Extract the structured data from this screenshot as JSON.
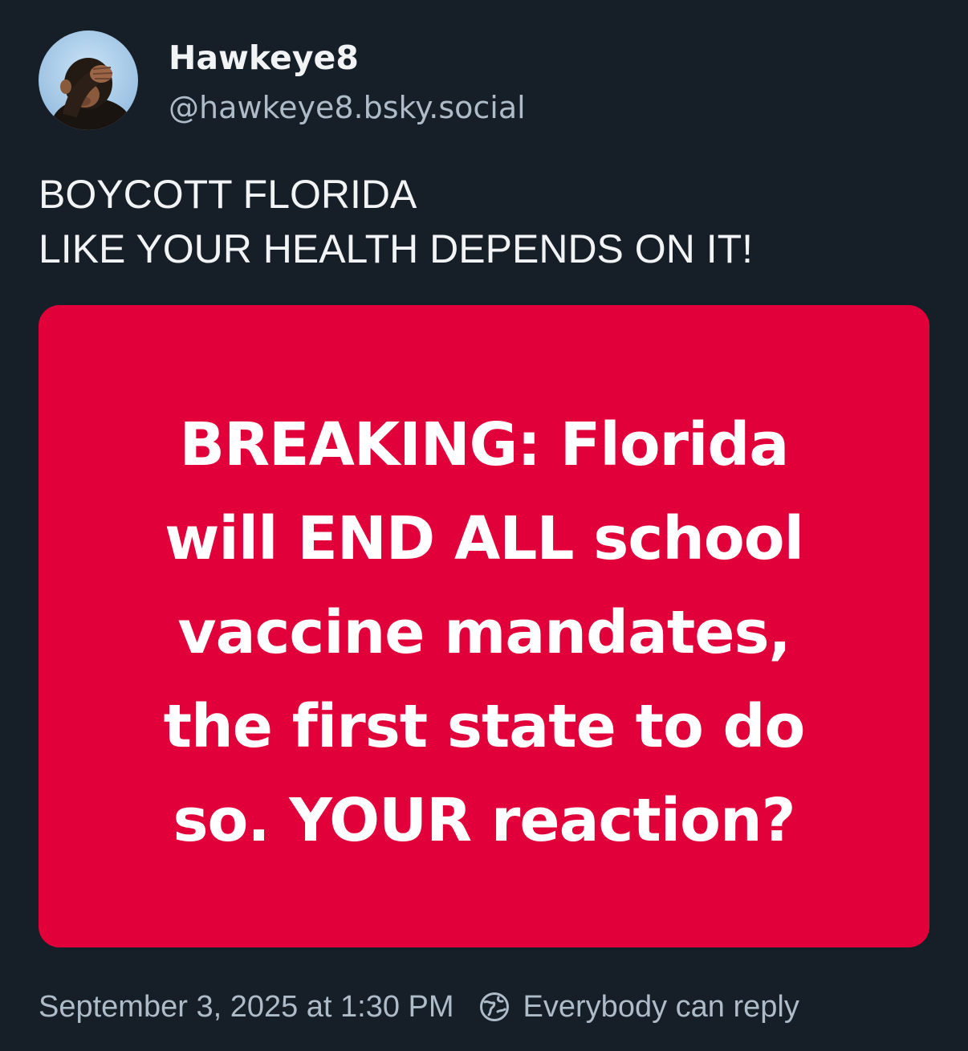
{
  "author": {
    "display_name": "Hawkeye8",
    "handle": "@hawkeye8.bsky.social",
    "avatar_icon": "monkey-facepalm-avatar"
  },
  "post": {
    "text_lines": [
      "BOYCOTT FLORIDA",
      "LIKE YOUR HEALTH DEPENDS ON IT!"
    ]
  },
  "embed": {
    "background_color": "#e2003a",
    "text_lines": [
      "BREAKING: Florida",
      "will END ALL school",
      "vaccine mandates,",
      "the first state to do",
      "so. YOUR reaction?"
    ]
  },
  "meta": {
    "timestamp": "September 3, 2025 at 1:30 PM",
    "reply_setting": "Everybody can reply",
    "reply_icon": "globe-icon"
  },
  "colors": {
    "background": "#161e27",
    "primary_text": "#f1f3f5",
    "secondary_text": "#aebbc9"
  }
}
